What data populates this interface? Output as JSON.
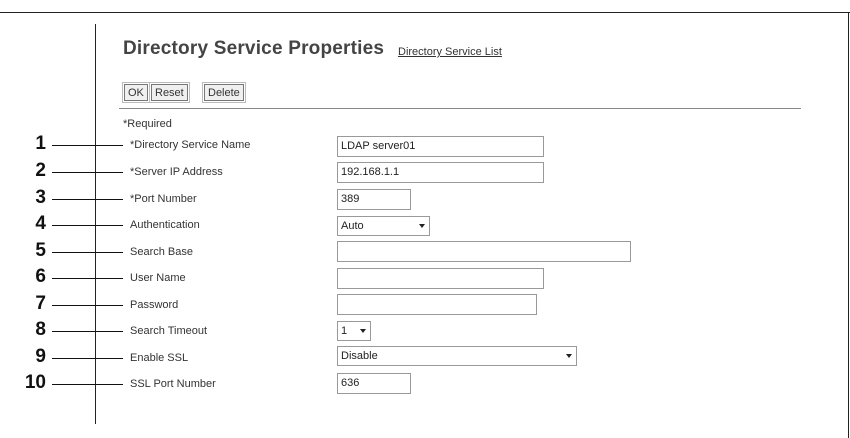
{
  "header": {
    "title": "Directory Service Properties",
    "link": "Directory Service List"
  },
  "toolbar": {
    "ok_label": "OK",
    "reset_label": "Reset",
    "delete_label": "Delete"
  },
  "required_note": "*Required",
  "callouts": [
    "1",
    "2",
    "3",
    "4",
    "5",
    "6",
    "7",
    "8",
    "9",
    "10"
  ],
  "fields": {
    "directory_service_name": {
      "label": "*Directory Service Name",
      "value": "LDAP server01"
    },
    "server_ip": {
      "label": "*Server IP Address",
      "value": "192.168.1.1"
    },
    "port_number": {
      "label": "*Port Number",
      "value": "389"
    },
    "authentication": {
      "label": "Authentication",
      "value": "Auto"
    },
    "search_base": {
      "label": "Search Base",
      "value": ""
    },
    "user_name": {
      "label": "User Name",
      "value": ""
    },
    "password": {
      "label": "Password",
      "value": ""
    },
    "search_timeout": {
      "label": "Search Timeout",
      "value": "1"
    },
    "enable_ssl": {
      "label": "Enable SSL",
      "value": "Disable"
    },
    "ssl_port": {
      "label": "SSL Port Number",
      "value": "636"
    }
  },
  "icons": {
    "dropdown": "chevron-down-icon"
  }
}
